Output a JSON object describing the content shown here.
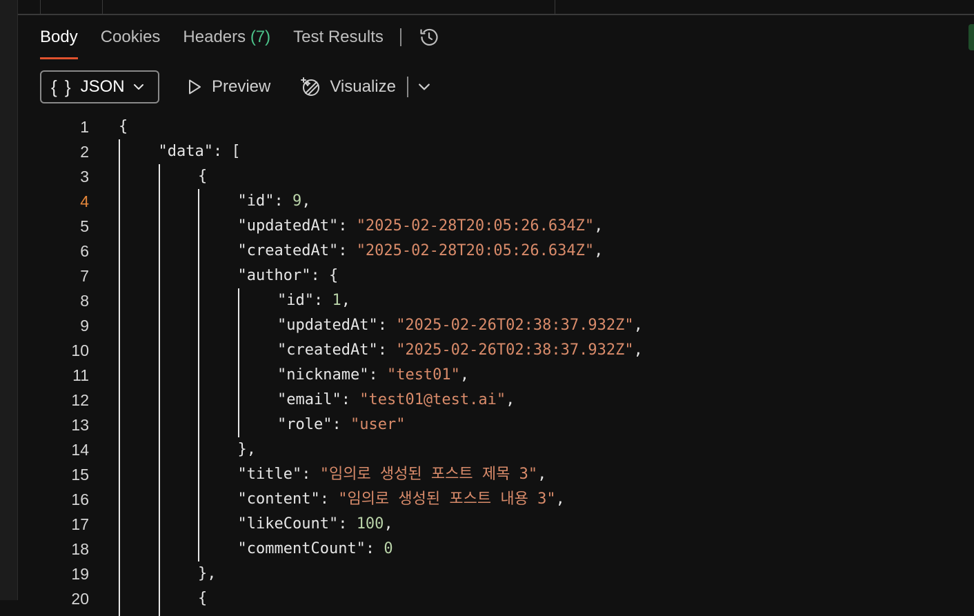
{
  "tabs": [
    {
      "label": "Body",
      "active": true
    },
    {
      "label": "Cookies"
    },
    {
      "label": "Headers",
      "count": "(7)"
    },
    {
      "label": "Test Results"
    }
  ],
  "toolbar": {
    "format_label": "JSON",
    "preview_label": "Preview",
    "visualize_label": "Visualize"
  },
  "colors": {
    "accent": "#e0522e",
    "count": "#4cc38a",
    "string": "#d98b6a",
    "number": "#b9d3a8",
    "current_line": "#e6873a"
  },
  "editor": {
    "current_line": 4,
    "lines": [
      {
        "n": "1",
        "indent": 0,
        "tokens": [
          {
            "t": "p",
            "v": "{"
          }
        ]
      },
      {
        "n": "2",
        "indent": 1,
        "tokens": [
          {
            "t": "p",
            "v": "\"data\": ["
          }
        ]
      },
      {
        "n": "3",
        "indent": 2,
        "tokens": [
          {
            "t": "p",
            "v": "{"
          }
        ]
      },
      {
        "n": "4",
        "indent": 3,
        "tokens": [
          {
            "t": "p",
            "v": "\"id\": "
          },
          {
            "t": "n",
            "v": "9"
          },
          {
            "t": "p",
            "v": ","
          }
        ]
      },
      {
        "n": "5",
        "indent": 3,
        "tokens": [
          {
            "t": "p",
            "v": "\"updatedAt\": "
          },
          {
            "t": "s",
            "v": "\"2025-02-28T20:05:26.634Z\""
          },
          {
            "t": "p",
            "v": ","
          }
        ]
      },
      {
        "n": "6",
        "indent": 3,
        "tokens": [
          {
            "t": "p",
            "v": "\"createdAt\": "
          },
          {
            "t": "s",
            "v": "\"2025-02-28T20:05:26.634Z\""
          },
          {
            "t": "p",
            "v": ","
          }
        ]
      },
      {
        "n": "7",
        "indent": 3,
        "tokens": [
          {
            "t": "p",
            "v": "\"author\": {"
          }
        ]
      },
      {
        "n": "8",
        "indent": 4,
        "tokens": [
          {
            "t": "p",
            "v": "\"id\": "
          },
          {
            "t": "n",
            "v": "1"
          },
          {
            "t": "p",
            "v": ","
          }
        ]
      },
      {
        "n": "9",
        "indent": 4,
        "tokens": [
          {
            "t": "p",
            "v": "\"updatedAt\": "
          },
          {
            "t": "s",
            "v": "\"2025-02-26T02:38:37.932Z\""
          },
          {
            "t": "p",
            "v": ","
          }
        ]
      },
      {
        "n": "10",
        "indent": 4,
        "tokens": [
          {
            "t": "p",
            "v": "\"createdAt\": "
          },
          {
            "t": "s",
            "v": "\"2025-02-26T02:38:37.932Z\""
          },
          {
            "t": "p",
            "v": ","
          }
        ]
      },
      {
        "n": "11",
        "indent": 4,
        "tokens": [
          {
            "t": "p",
            "v": "\"nickname\": "
          },
          {
            "t": "s",
            "v": "\"test01\""
          },
          {
            "t": "p",
            "v": ","
          }
        ]
      },
      {
        "n": "12",
        "indent": 4,
        "tokens": [
          {
            "t": "p",
            "v": "\"email\": "
          },
          {
            "t": "s",
            "v": "\"test01@test.ai\""
          },
          {
            "t": "p",
            "v": ","
          }
        ]
      },
      {
        "n": "13",
        "indent": 4,
        "tokens": [
          {
            "t": "p",
            "v": "\"role\": "
          },
          {
            "t": "s",
            "v": "\"user\""
          }
        ]
      },
      {
        "n": "14",
        "indent": 3,
        "tokens": [
          {
            "t": "p",
            "v": "},"
          }
        ]
      },
      {
        "n": "15",
        "indent": 3,
        "tokens": [
          {
            "t": "p",
            "v": "\"title\": "
          },
          {
            "t": "s",
            "v": "\"임의로 생성된 포스트 제목 3\""
          },
          {
            "t": "p",
            "v": ","
          }
        ]
      },
      {
        "n": "16",
        "indent": 3,
        "tokens": [
          {
            "t": "p",
            "v": "\"content\": "
          },
          {
            "t": "s",
            "v": "\"임의로 생성된 포스트 내용 3\""
          },
          {
            "t": "p",
            "v": ","
          }
        ]
      },
      {
        "n": "17",
        "indent": 3,
        "tokens": [
          {
            "t": "p",
            "v": "\"likeCount\": "
          },
          {
            "t": "n",
            "v": "100"
          },
          {
            "t": "p",
            "v": ","
          }
        ]
      },
      {
        "n": "18",
        "indent": 3,
        "tokens": [
          {
            "t": "p",
            "v": "\"commentCount\": "
          },
          {
            "t": "n",
            "v": "0"
          }
        ]
      },
      {
        "n": "19",
        "indent": 2,
        "tokens": [
          {
            "t": "p",
            "v": "},"
          }
        ]
      },
      {
        "n": "20",
        "indent": 2,
        "tokens": [
          {
            "t": "p",
            "v": "{"
          }
        ]
      }
    ]
  }
}
